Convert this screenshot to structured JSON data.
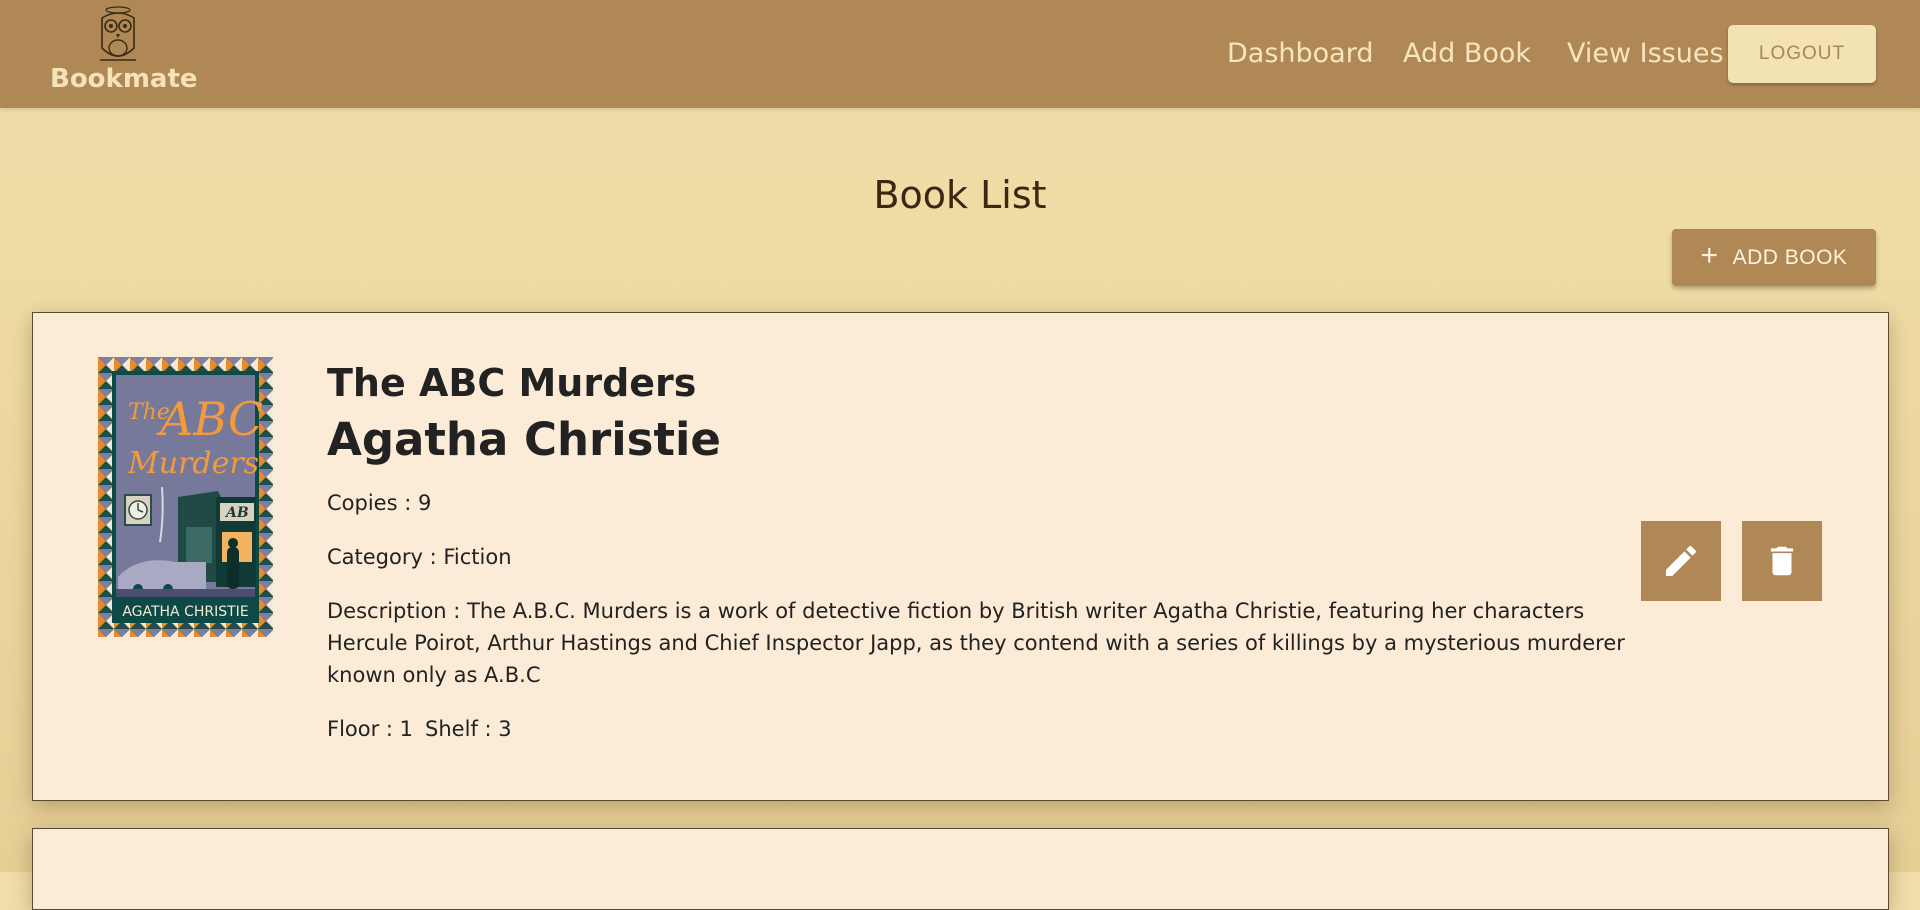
{
  "navbar": {
    "brand": "Bookmate",
    "links": [
      {
        "label": "Dashboard"
      },
      {
        "label": "Add Book"
      },
      {
        "label": "View Issues"
      }
    ],
    "logout_label": "LOGOUT"
  },
  "page": {
    "title": "Book List",
    "add_book_label": "ADD BOOK",
    "add_icon": "plus-icon"
  },
  "books": [
    {
      "title": "The ABC Murders",
      "author": "Agatha Christie",
      "copies_label": "Copies : ",
      "copies": "9",
      "category_label": "Category : ",
      "category": "Fiction",
      "description_label": "Description : ",
      "description": "The A.B.C. Murders is a work of detective fiction by British writer Agatha Christie, featuring her characters Hercule Poirot, Arthur Hastings and Chief Inspector Japp, as they contend with a series of killings by a mysterious murderer known only as A.B.C",
      "floor_label": "Floor : ",
      "floor": "1",
      "shelf_label": "Shelf : ",
      "shelf": "3",
      "cover": {
        "title_line1": "The",
        "title_line2": "ABC",
        "title_line3": "Murders",
        "author": "AGATHA CHRISTIE",
        "sign": "AB"
      },
      "edit_icon": "pencil-icon",
      "delete_icon": "trash-icon"
    }
  ],
  "colors": {
    "navbar": "#b08856",
    "nav_text": "#f7e6bd",
    "background": "#eedaa2",
    "card": "#fcebd6",
    "accent": "#b08856"
  }
}
